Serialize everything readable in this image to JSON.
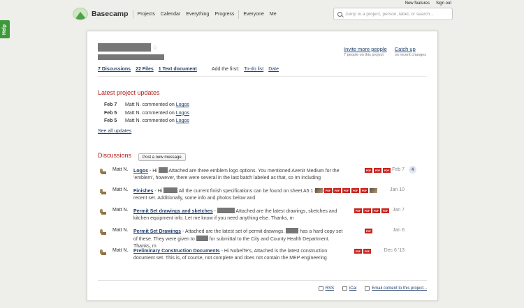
{
  "help_tab": "Help",
  "top_links": [
    "New features",
    "Sign out"
  ],
  "logo_text": "Basecamp",
  "nav": [
    "Projects",
    "Calendar",
    "Everything",
    "Progress",
    "Everyone",
    "Me"
  ],
  "search": {
    "placeholder": "Jump to a project, person, label, or search..."
  },
  "actions": [
    {
      "label": "Invite more people",
      "sub": "7 people on this project"
    },
    {
      "label": "Catch up",
      "sub": "on recent changes"
    }
  ],
  "counts": [
    "7 Discussions",
    "22 Files",
    "1 Text document"
  ],
  "add_first": {
    "label": "Add the first:",
    "links": [
      "To-do list",
      "Date"
    ]
  },
  "latest": {
    "title": "Latest project updates",
    "items": [
      {
        "date": "Feb 7",
        "text": "Matt N. commented on",
        "link": "Logos"
      },
      {
        "date": "Feb 5",
        "text": "Matt N. commented on",
        "link": "Logos"
      },
      {
        "date": "Feb 5",
        "text": "Matt N. commented on",
        "link": "Logos"
      }
    ],
    "see_all": "See all updates"
  },
  "discussions": {
    "title": "Discussions",
    "post_button": "Post a new message",
    "items": [
      {
        "author": "Matt N.",
        "title": "Logos",
        "pre": " - Hi ",
        "text": " Attached are three emblem logo options. You mentioned Avenir Medium for the 'emblem', however, there were several in the last batch labeled as that, so Im including",
        "date": "Feb 7",
        "count": "4"
      },
      {
        "author": "Matt N.",
        "title": "Finishes",
        "pre": " - Hi ",
        "text": " All the current finish specifications can be found on sheet A5.1 of the most recent set. Additionally, some info and photos below and",
        "date": "Jan 10",
        "count": ""
      },
      {
        "author": "Matt N.",
        "title": "Permit Set drawings and sketches",
        "pre": " - ",
        "text": " Attached are the latest drawings, sketches and kitchen equipment info. Let me know if you need anything else. Thanks, m",
        "date": "Jan 7",
        "count": ""
      },
      {
        "author": "Matt N.",
        "title": "Permit Set Drawings",
        "pre": " - Attached are the latest set of permit drawings. ",
        "text": " has a hard copy set of these. They were given to ",
        "text2": " for submittal to the City and County Health Department. Thanks, m",
        "date": "Jan 6",
        "count": ""
      },
      {
        "author": "Matt N.",
        "title": "Preliminary Construction Documents",
        "pre": " - Hi NobelTe's, Attached is the latest construction document set. This is, of course, not complete and does not contain the MEP engineering",
        "text": "",
        "date": "Dec 6 '13",
        "count": ""
      }
    ]
  },
  "pdf_label": "PDF",
  "footer": [
    "RSS",
    "iCal",
    "Email content to this project..."
  ]
}
